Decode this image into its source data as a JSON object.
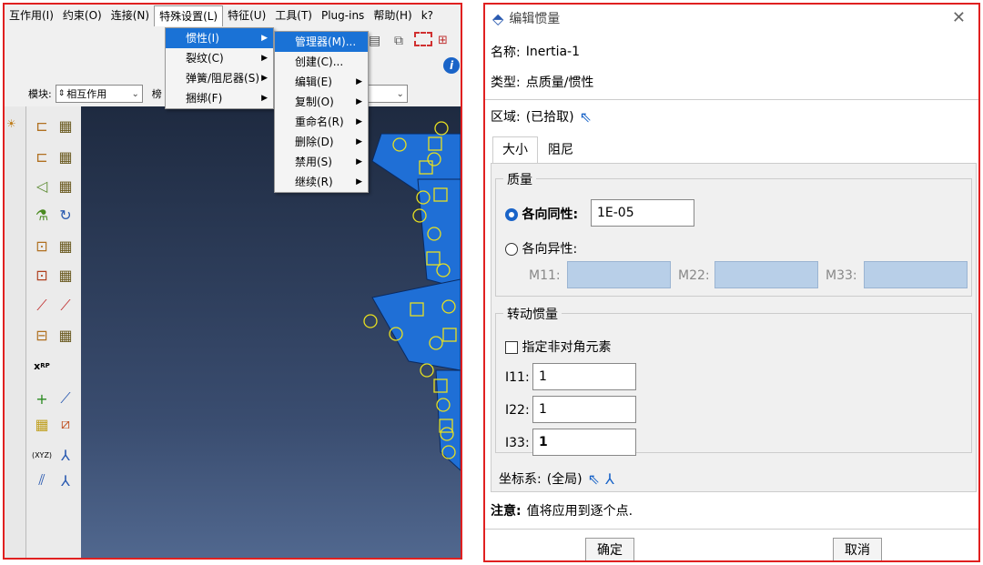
{
  "menubar": {
    "items": [
      "互作用(I)",
      "约束(O)",
      "连接(N)",
      "特殊设置(L)",
      "特征(U)",
      "工具(T)",
      "Plug-ins",
      "帮助(H)",
      "k?"
    ]
  },
  "module_row": {
    "label": "模块:",
    "value": "相互作用",
    "extra": "榜"
  },
  "menu_special": {
    "items": [
      {
        "label": "惯性(I)",
        "sub": true
      },
      {
        "label": "裂纹(C)",
        "sub": true
      },
      {
        "label": "弹簧/阻尼器(S)",
        "sub": true
      },
      {
        "label": "捆绑(F)",
        "sub": true
      }
    ]
  },
  "menu_inertia": {
    "items": [
      {
        "label": "管理器(M)...",
        "sub": false
      },
      {
        "label": "创建(C)...",
        "sub": false
      },
      {
        "label": "编辑(E)",
        "sub": true
      },
      {
        "label": "复制(O)",
        "sub": true
      },
      {
        "label": "重命名(R)",
        "sub": true
      },
      {
        "label": "删除(D)",
        "sub": true
      },
      {
        "label": "禁用(S)",
        "sub": true
      },
      {
        "label": "继续(R)",
        "sub": true
      }
    ]
  },
  "dialog": {
    "title": "编辑惯量",
    "name_label": "名称:",
    "name_value": "Inertia-1",
    "type_label": "类型:",
    "type_value": "点质量/惯性",
    "region_label": "区域:",
    "region_value": "(已拾取)",
    "tabs": [
      "大小",
      "阻尼"
    ],
    "mass_group": "质量",
    "isotropic_label": "各向同性:",
    "isotropic_value": "1E-05",
    "anisotropic_label": "各向异性:",
    "m11": "M11:",
    "m22": "M22:",
    "m33": "M33:",
    "rot_group": "转动惯量",
    "offdiag_label": "指定非对角元素",
    "i11_label": "I11:",
    "i11_value": "1",
    "i22_label": "I22:",
    "i22_value": "1",
    "i33_label": "I33:",
    "i33_value": "1",
    "csys_label": "坐标系:",
    "csys_value": "(全局)",
    "note_label": "注意:",
    "note_text": "值将应用到逐个点.",
    "ok": "确定",
    "cancel": "取消"
  },
  "colors": {
    "highlight": "#1a72d6",
    "border_red": "#e02020",
    "mesh_blue": "#1f6fd6",
    "marker_yellow": "#e8e020"
  }
}
